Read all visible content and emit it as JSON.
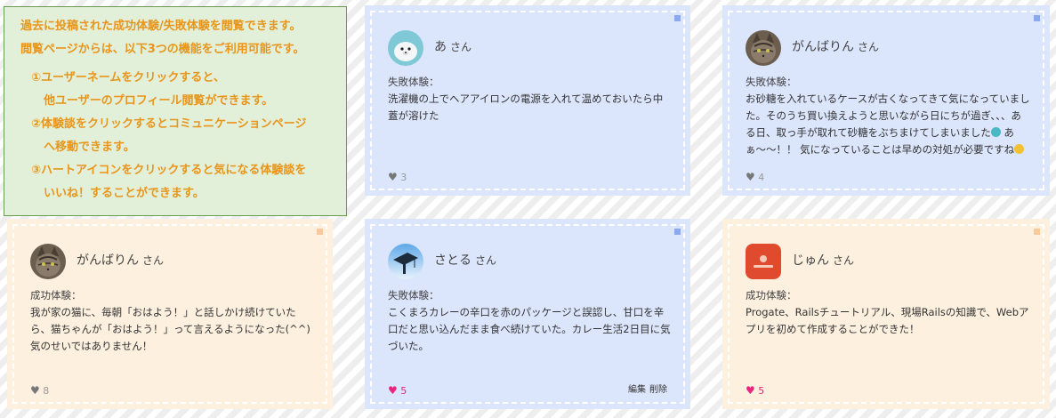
{
  "intro": {
    "line1": "過去に投稿された成功体験/失敗体験を閲覧できます。",
    "line2": "閲覧ページからは、以下3つの機能をご利用可能です。",
    "features": [
      {
        "line1": "①ユーザーネームをクリックすると、",
        "line2": "他ユーザーのプロフィール閲覧ができます。"
      },
      {
        "line1": "②体験談をクリックするとコミュニケーションページ",
        "line2": "へ移動できます。"
      },
      {
        "line1": "③ハートアイコンをクリックすると気になる体験談を",
        "line2": "いいね！することができます。"
      }
    ]
  },
  "san_suffix": "さん",
  "edit_label": "編集",
  "delete_label": "削除",
  "heart_icon": "heart-icon",
  "colors": {
    "fail_bg": "#dbe5fc",
    "success_bg": "#fdf0df",
    "liked_heart": "#e8267d",
    "intro_text": "#e8951b",
    "intro_bg": "#e2f0d9"
  },
  "cards": [
    {
      "type": "fail",
      "username": "あ",
      "label": "失敗体験：",
      "body": "洗濯機の上でヘアアイロンの電源を入れて温めておいたら中蓋が溶けた",
      "likes": "3",
      "liked": false,
      "avatar_icon": "seal-avatar-icon"
    },
    {
      "type": "fail",
      "username": "がんばりん",
      "label": "失敗体験：",
      "body_part1": "お砂糖を入れているケースが古くなってきて気になっていました。そのうち買い換えようと思いながら日にちが過ぎ、、、ある日、取っ手が取れて砂糖をぶちまけてしまいました",
      "body_part2": " あぁ〜〜！！ 気になっていることは早めの対処が必要ですね",
      "likes": "4",
      "liked": false,
      "avatar_icon": "cat-avatar-icon"
    },
    {
      "type": "success",
      "username": "がんばりん",
      "label": "成功体験：",
      "body": "我が家の猫に、毎朝「おはよう！」と話しかけ続けていたら、猫ちゃんが「おはよう！」って言えるようになった(^^) 気のせいではありません！",
      "likes": "8",
      "liked": false,
      "avatar_icon": "cat-avatar-icon"
    },
    {
      "type": "fail",
      "username": "さとる",
      "label": "失敗体験：",
      "body": "こくまろカレーの辛口を赤のパッケージと誤認し、甘口を辛口だと思い込んだまま食べ続けていた。カレー生活2日目に気づいた。",
      "likes": "5",
      "liked": true,
      "avatar_icon": "graduation-avatar-icon"
    },
    {
      "type": "success",
      "username": "じゅん",
      "label": "成功体験：",
      "body": "Progate、Railsチュートリアル、現場Railsの知識で、Webアプリを初めて作成することができた！",
      "likes": "5",
      "liked": true,
      "avatar_icon": "app-logo-avatar-icon"
    }
  ]
}
